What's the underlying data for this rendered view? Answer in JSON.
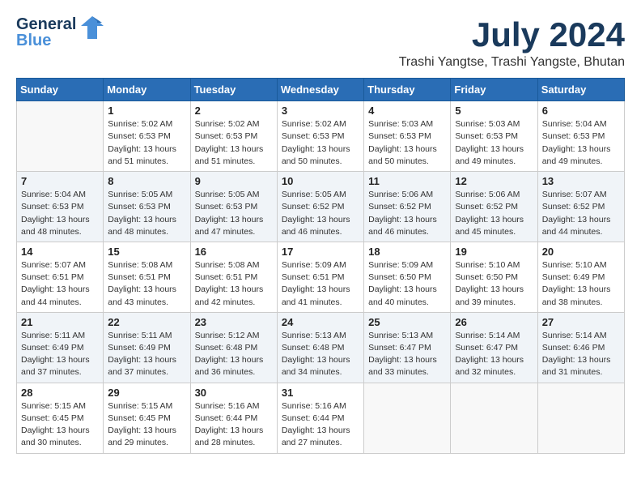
{
  "header": {
    "logo_line1": "General",
    "logo_line2": "Blue",
    "month": "July 2024",
    "location": "Trashi Yangtse, Trashi Yangste, Bhutan"
  },
  "weekdays": [
    "Sunday",
    "Monday",
    "Tuesday",
    "Wednesday",
    "Thursday",
    "Friday",
    "Saturday"
  ],
  "weeks": [
    [
      {
        "day": "",
        "info": ""
      },
      {
        "day": "1",
        "info": "Sunrise: 5:02 AM\nSunset: 6:53 PM\nDaylight: 13 hours\nand 51 minutes."
      },
      {
        "day": "2",
        "info": "Sunrise: 5:02 AM\nSunset: 6:53 PM\nDaylight: 13 hours\nand 51 minutes."
      },
      {
        "day": "3",
        "info": "Sunrise: 5:02 AM\nSunset: 6:53 PM\nDaylight: 13 hours\nand 50 minutes."
      },
      {
        "day": "4",
        "info": "Sunrise: 5:03 AM\nSunset: 6:53 PM\nDaylight: 13 hours\nand 50 minutes."
      },
      {
        "day": "5",
        "info": "Sunrise: 5:03 AM\nSunset: 6:53 PM\nDaylight: 13 hours\nand 49 minutes."
      },
      {
        "day": "6",
        "info": "Sunrise: 5:04 AM\nSunset: 6:53 PM\nDaylight: 13 hours\nand 49 minutes."
      }
    ],
    [
      {
        "day": "7",
        "info": "Sunrise: 5:04 AM\nSunset: 6:53 PM\nDaylight: 13 hours\nand 48 minutes."
      },
      {
        "day": "8",
        "info": "Sunrise: 5:05 AM\nSunset: 6:53 PM\nDaylight: 13 hours\nand 48 minutes."
      },
      {
        "day": "9",
        "info": "Sunrise: 5:05 AM\nSunset: 6:53 PM\nDaylight: 13 hours\nand 47 minutes."
      },
      {
        "day": "10",
        "info": "Sunrise: 5:05 AM\nSunset: 6:52 PM\nDaylight: 13 hours\nand 46 minutes."
      },
      {
        "day": "11",
        "info": "Sunrise: 5:06 AM\nSunset: 6:52 PM\nDaylight: 13 hours\nand 46 minutes."
      },
      {
        "day": "12",
        "info": "Sunrise: 5:06 AM\nSunset: 6:52 PM\nDaylight: 13 hours\nand 45 minutes."
      },
      {
        "day": "13",
        "info": "Sunrise: 5:07 AM\nSunset: 6:52 PM\nDaylight: 13 hours\nand 44 minutes."
      }
    ],
    [
      {
        "day": "14",
        "info": "Sunrise: 5:07 AM\nSunset: 6:51 PM\nDaylight: 13 hours\nand 44 minutes."
      },
      {
        "day": "15",
        "info": "Sunrise: 5:08 AM\nSunset: 6:51 PM\nDaylight: 13 hours\nand 43 minutes."
      },
      {
        "day": "16",
        "info": "Sunrise: 5:08 AM\nSunset: 6:51 PM\nDaylight: 13 hours\nand 42 minutes."
      },
      {
        "day": "17",
        "info": "Sunrise: 5:09 AM\nSunset: 6:51 PM\nDaylight: 13 hours\nand 41 minutes."
      },
      {
        "day": "18",
        "info": "Sunrise: 5:09 AM\nSunset: 6:50 PM\nDaylight: 13 hours\nand 40 minutes."
      },
      {
        "day": "19",
        "info": "Sunrise: 5:10 AM\nSunset: 6:50 PM\nDaylight: 13 hours\nand 39 minutes."
      },
      {
        "day": "20",
        "info": "Sunrise: 5:10 AM\nSunset: 6:49 PM\nDaylight: 13 hours\nand 38 minutes."
      }
    ],
    [
      {
        "day": "21",
        "info": "Sunrise: 5:11 AM\nSunset: 6:49 PM\nDaylight: 13 hours\nand 37 minutes."
      },
      {
        "day": "22",
        "info": "Sunrise: 5:11 AM\nSunset: 6:49 PM\nDaylight: 13 hours\nand 37 minutes."
      },
      {
        "day": "23",
        "info": "Sunrise: 5:12 AM\nSunset: 6:48 PM\nDaylight: 13 hours\nand 36 minutes."
      },
      {
        "day": "24",
        "info": "Sunrise: 5:13 AM\nSunset: 6:48 PM\nDaylight: 13 hours\nand 34 minutes."
      },
      {
        "day": "25",
        "info": "Sunrise: 5:13 AM\nSunset: 6:47 PM\nDaylight: 13 hours\nand 33 minutes."
      },
      {
        "day": "26",
        "info": "Sunrise: 5:14 AM\nSunset: 6:47 PM\nDaylight: 13 hours\nand 32 minutes."
      },
      {
        "day": "27",
        "info": "Sunrise: 5:14 AM\nSunset: 6:46 PM\nDaylight: 13 hours\nand 31 minutes."
      }
    ],
    [
      {
        "day": "28",
        "info": "Sunrise: 5:15 AM\nSunset: 6:45 PM\nDaylight: 13 hours\nand 30 minutes."
      },
      {
        "day": "29",
        "info": "Sunrise: 5:15 AM\nSunset: 6:45 PM\nDaylight: 13 hours\nand 29 minutes."
      },
      {
        "day": "30",
        "info": "Sunrise: 5:16 AM\nSunset: 6:44 PM\nDaylight: 13 hours\nand 28 minutes."
      },
      {
        "day": "31",
        "info": "Sunrise: 5:16 AM\nSunset: 6:44 PM\nDaylight: 13 hours\nand 27 minutes."
      },
      {
        "day": "",
        "info": ""
      },
      {
        "day": "",
        "info": ""
      },
      {
        "day": "",
        "info": ""
      }
    ]
  ]
}
